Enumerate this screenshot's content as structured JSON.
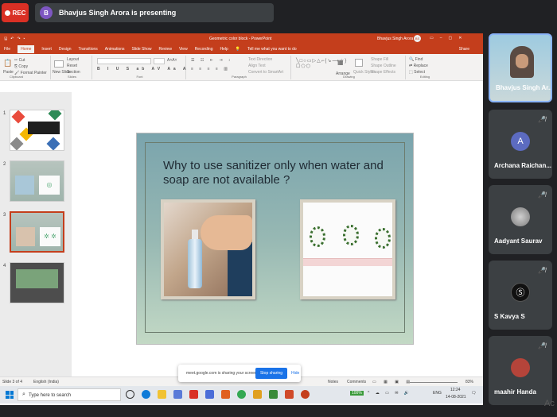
{
  "meet": {
    "rec_label": "REC",
    "presenter_initial": "B",
    "presenting_text": "Bhavjus Singh Arora is presenting"
  },
  "ppt": {
    "title": "Geometric color block - PowerPoint",
    "user": "Bhavjus Singh Arora",
    "user_badge": "BS",
    "menu": [
      "File",
      "Home",
      "Insert",
      "Design",
      "Transitions",
      "Animations",
      "Slide Show",
      "Review",
      "View",
      "Recording",
      "Help"
    ],
    "tell_me": "Tell me what you want to do",
    "share": "Share",
    "ribbon": {
      "paste": "Paste",
      "cut": "Cut",
      "copy": "Copy",
      "format_painter": "Format Painter",
      "clipboard": "Clipboard",
      "new_slide": "New Slide",
      "layout": "Layout",
      "reset": "Reset",
      "section": "Section",
      "slides": "Slides",
      "font": "Font",
      "text_direction": "Text Direction",
      "align_text": "Align Text",
      "convert_smartart": "Convert to SmartArt",
      "paragraph": "Paragraph",
      "arrange": "Arrange",
      "quick_styles": "Quick Styles",
      "shape_fill": "Shape Fill",
      "shape_outline": "Shape Outline",
      "shape_effects": "Shape Effects",
      "drawing": "Drawing",
      "find": "Find",
      "replace": "Replace",
      "select": "Select",
      "editing": "Editing"
    },
    "thumbnails": [
      "1",
      "2",
      "3",
      "4"
    ],
    "slide_title": "Why to use sanitizer only when water and soap are not available ?",
    "status": {
      "slide_of": "Slide 3 of 4",
      "language": "English (India)",
      "notes": "Notes",
      "comments": "Comments",
      "zoom": "83%"
    }
  },
  "sharing": {
    "text": "meet.google.com is sharing your screen.",
    "stop": "Stop sharing",
    "hide": "Hide"
  },
  "taskbar": {
    "search_placeholder": "Type here to search",
    "battery": "100%",
    "lang": "ENG",
    "time": "12:24",
    "date": "14-08-2021"
  },
  "participants": [
    {
      "name": "Bhavjus Singh Ar...",
      "initial": "",
      "color": ""
    },
    {
      "name": "Archana Raichan...",
      "initial": "A",
      "color": "#5c6bc0"
    },
    {
      "name": "Aadyant Saurav",
      "initial": "",
      "color": "#8a8a8a"
    },
    {
      "name": "S Kavya S",
      "initial": "",
      "color": "#111111"
    },
    {
      "name": "maahir Handa",
      "initial": "",
      "color": "#b5443a"
    }
  ],
  "watermark": "Ac",
  "colors": {
    "accent": "#c43e1c",
    "meet_bg": "#202124",
    "rec": "#d93025",
    "stop": "#1a73e8"
  }
}
